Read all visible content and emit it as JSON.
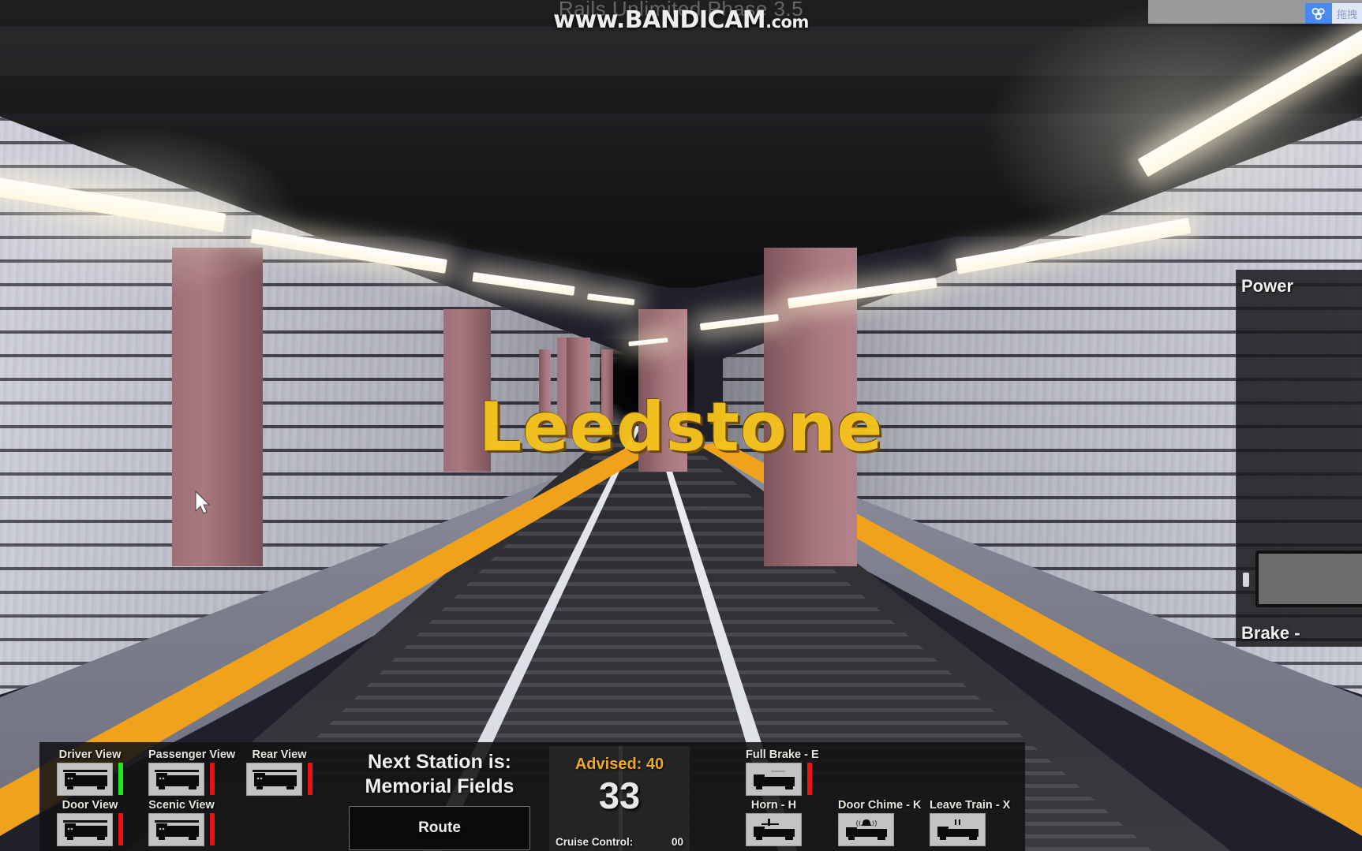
{
  "watermarks": {
    "game_title": "Rails Unlimited  Phase 3.5",
    "recorder_main": "www.BANDICAM",
    "recorder_suffix": ".com",
    "corner_badge_icon": "three-circles-logo",
    "corner_badge_text": "拖拽"
  },
  "scene": {
    "station_sign_text": "Leedstone",
    "cursor_icon": "mouse-pointer-icon"
  },
  "throttle_panel": {
    "power_label": "Power",
    "brake_label": "Brake -",
    "knob_icon": "throttle-knob"
  },
  "hud": {
    "camera_buttons": [
      {
        "label": "Driver View",
        "icon": "train-side-icon",
        "status_color": "#1ee81e"
      },
      {
        "label": "Passenger View",
        "icon": "train-side-icon",
        "status_color": "#e81414"
      },
      {
        "label": "Rear View",
        "icon": "train-side-icon",
        "status_color": "#e81414"
      },
      {
        "label": "Door View",
        "icon": "train-side-icon",
        "status_color": "#e81414"
      },
      {
        "label": "Scenic View",
        "icon": "train-side-icon",
        "status_color": "#e81414"
      }
    ],
    "center": {
      "next_station_label": "Next Station is:",
      "next_station_name": "Memorial Fields",
      "route_button": "Route"
    },
    "speed": {
      "advised_label": "Advised: 40",
      "current_speed": "33",
      "cruise_label": "Cruise Control:",
      "cruise_value": "00"
    },
    "control_buttons": [
      {
        "label": "Full Brake - E",
        "icon": "train-brake-icon",
        "status_color": "#e81414"
      },
      {
        "label": "Horn - H",
        "icon": "train-horn-icon",
        "status_color": null
      },
      {
        "label": "Door Chime - K",
        "icon": "train-chime-icon",
        "status_color": null
      },
      {
        "label": "Leave Train - X",
        "icon": "train-leave-icon",
        "status_color": null
      }
    ]
  },
  "colors": {
    "accent_amber": "#f0a81c",
    "status_active": "#1ee81e",
    "status_inactive": "#e81414",
    "hud_background": "#121214",
    "pillar": "#a8787f",
    "platform_line": "#f0a31a"
  }
}
